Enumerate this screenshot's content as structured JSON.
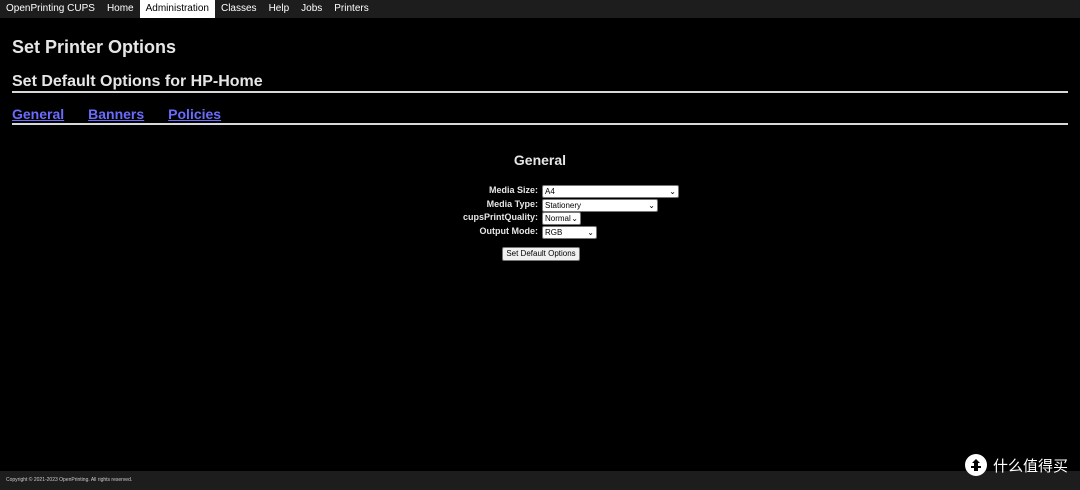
{
  "nav": {
    "items": [
      {
        "label": "OpenPrinting CUPS",
        "active": false
      },
      {
        "label": "Home",
        "active": false
      },
      {
        "label": "Administration",
        "active": true
      },
      {
        "label": "Classes",
        "active": false
      },
      {
        "label": "Help",
        "active": false
      },
      {
        "label": "Jobs",
        "active": false
      },
      {
        "label": "Printers",
        "active": false
      }
    ]
  },
  "page": {
    "title": "Set Printer Options",
    "subtitle": "Set Default Options for HP-Home"
  },
  "tabs": [
    {
      "label": "General"
    },
    {
      "label": "Banners"
    },
    {
      "label": "Policies"
    }
  ],
  "section": {
    "title": "General"
  },
  "form": {
    "media_size": {
      "label": "Media Size:",
      "value": "A4"
    },
    "media_type": {
      "label": "Media Type:",
      "value": "Stationery"
    },
    "print_quality": {
      "label": "cupsPrintQuality:",
      "value": "Normal"
    },
    "output_mode": {
      "label": "Output Mode:",
      "value": "RGB"
    },
    "submit_label": "Set Default Options"
  },
  "footer": {
    "copyright": "Copyright © 2021-2023 OpenPrinting. All rights reserved."
  },
  "watermark": {
    "text": "什么值得买",
    "icon": "smzdm-logo-icon"
  },
  "colors": {
    "background": "#000000",
    "nav_bg": "#1d1d1d",
    "link": "#6b6bff",
    "rule": "#d8d8d8"
  }
}
